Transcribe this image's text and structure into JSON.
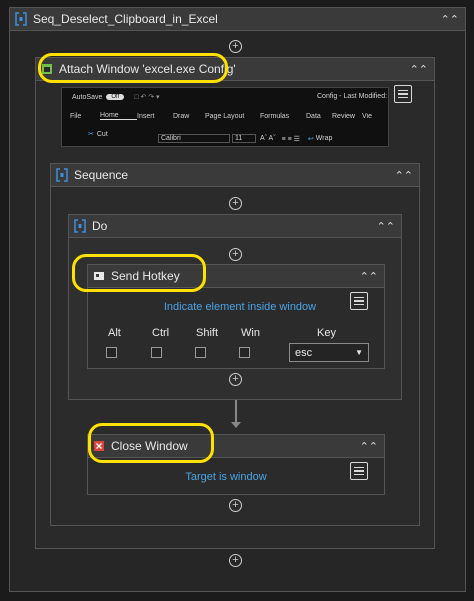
{
  "outer": {
    "title": "Seq_Deselect_Clipboard_in_Excel"
  },
  "attach": {
    "title": "Attach Window 'excel.exe Config'"
  },
  "excel": {
    "autosave": "AutoSave",
    "toggle": "Off",
    "config_label": "Config - Last Modified:",
    "tabs": [
      "File",
      "Home",
      "Insert",
      "Draw",
      "Page Layout",
      "Formulas",
      "Data",
      "Review",
      "Vie"
    ],
    "cut": "Cut",
    "font": "Calibri",
    "size": "11",
    "wrap": "Wrap"
  },
  "sequence": {
    "title": "Sequence"
  },
  "do": {
    "title": "Do"
  },
  "hotkey": {
    "title": "Send Hotkey",
    "indicate": "Indicate element inside window",
    "mods": [
      "Alt",
      "Ctrl",
      "Shift",
      "Win"
    ],
    "key_label": "Key",
    "key_value": "esc"
  },
  "close": {
    "title": "Close Window",
    "target": "Target is window"
  },
  "colors": {
    "highlight": "#ffe100",
    "link": "#4aa3e6"
  }
}
